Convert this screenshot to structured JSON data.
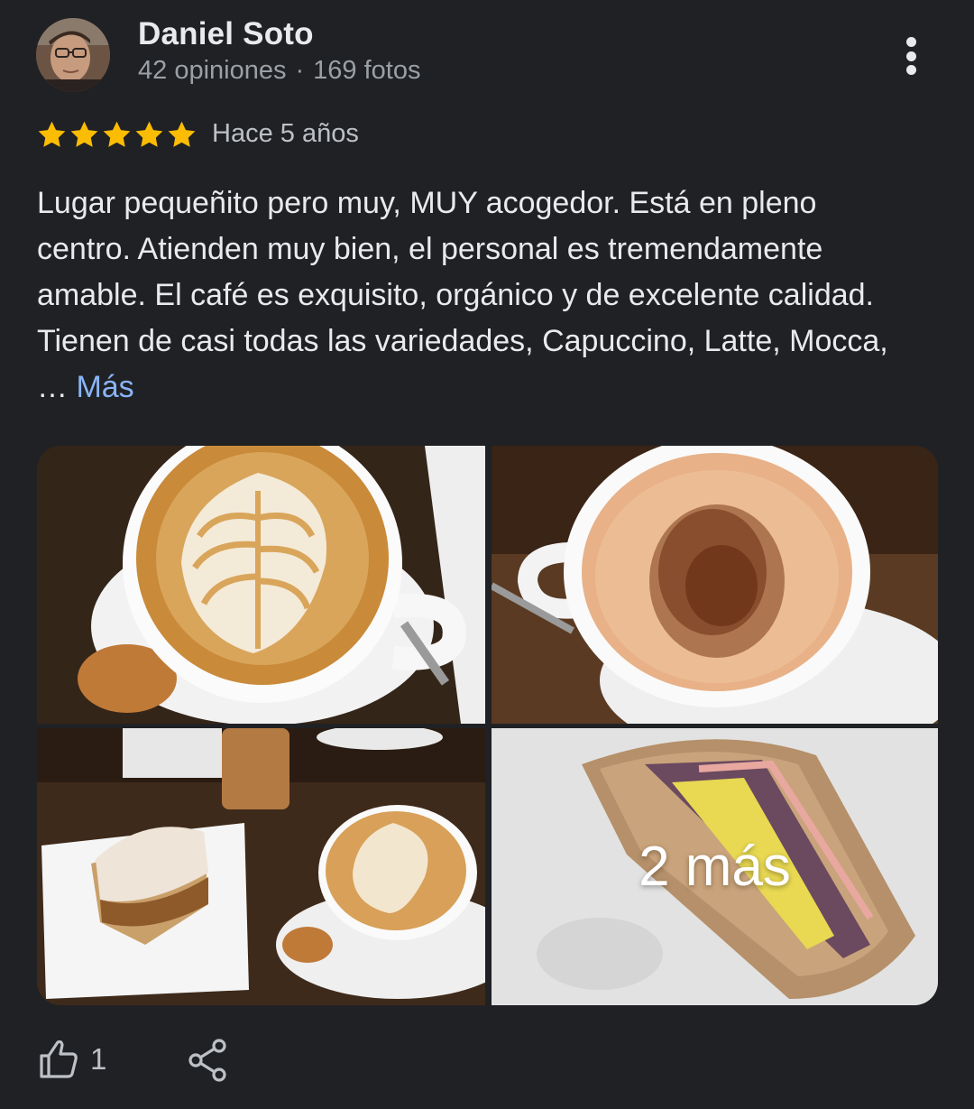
{
  "review": {
    "author": {
      "name": "Daniel Soto",
      "reviews_count": "42 opiniones",
      "separator": "·",
      "photos_count": "169 fotos",
      "avatar_icon": "user-avatar"
    },
    "menu_icon": "more-vert-icon",
    "rating": {
      "stars": 5,
      "max": 5,
      "color": "#fbbc04"
    },
    "time_ago": "Hace 5 años",
    "text_lines": [
      "Lugar pequeñito pero muy, MUY acogedor. Está en pleno",
      "centro. Atienden muy bien, el personal es tremendamente",
      "amable. El café es exquisito, orgánico y de excelente calidad.",
      "Tienen de casi todas las variedades, Capuccino, Latte, Mocca,"
    ],
    "ellipsis": "… ",
    "more_label": "Más",
    "photos": {
      "items": [
        "latte-art-photo",
        "mocha-cocoa-photo",
        "cake-and-latte-photo",
        "sandwich-photo"
      ],
      "more_overlay": "2 más"
    },
    "actions": {
      "like_icon": "thumb-up-icon",
      "like_count": "1",
      "share_icon": "share-icon"
    }
  },
  "colors": {
    "background": "#202124",
    "primary_text": "#e8eaed",
    "secondary_text": "#9aa0a6",
    "link": "#8ab4f8",
    "star": "#fbbc04"
  }
}
